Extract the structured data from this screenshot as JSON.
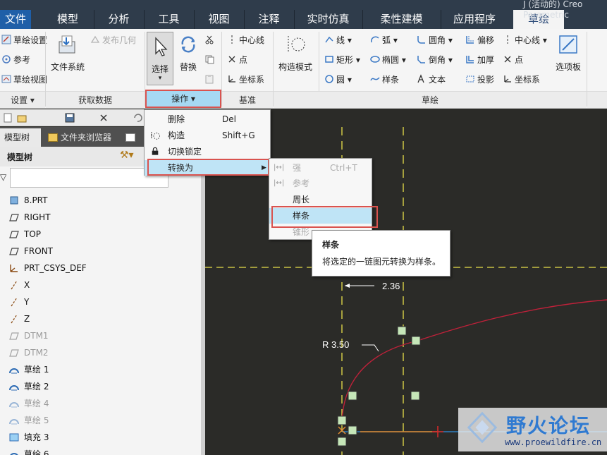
{
  "window": {
    "title_fragment": "J (活动的) Creo Parametric"
  },
  "menubar": {
    "tabs": [
      "文件",
      "模型",
      "分析",
      "工具",
      "视图",
      "注释",
      "实时仿真",
      "柔性建模",
      "应用程序",
      "草绘"
    ],
    "active": "草绘"
  },
  "ribbon": {
    "setup": {
      "sketch_setup": "草绘设置",
      "reference": "参考",
      "sketch_view": "草绘视图",
      "group": "设置"
    },
    "get_data": {
      "file_system": "文件系统",
      "publish_geom": "发布几何",
      "group": "获取数据"
    },
    "operations": {
      "select": "选择",
      "replace": "替换",
      "group": "操作"
    },
    "datum": {
      "centerline": "中心线",
      "point": "点",
      "csys": "坐标系",
      "group": "基准"
    },
    "sketch": {
      "construction_mode": "构造模式",
      "line": "线",
      "arc": "弧",
      "fillet": "圆角",
      "offset": "偏移",
      "rectangle": "矩形",
      "ellipse": "椭圆",
      "chamfer": "倒角",
      "thicken": "加厚",
      "circle": "圆",
      "spline": "样条",
      "text": "文本",
      "project": "投影",
      "centerline": "中心线",
      "point": "点",
      "csys": "坐标系",
      "group": "草绘"
    },
    "palette": "选项板"
  },
  "left_panel": {
    "tabs": [
      "模型树",
      "文件夹浏览器"
    ],
    "header": "模型树",
    "tree": [
      {
        "label": "8.PRT",
        "icon": "part-icon",
        "dim": false
      },
      {
        "label": "RIGHT",
        "icon": "datum-plane-icon",
        "dim": false
      },
      {
        "label": "TOP",
        "icon": "datum-plane-icon",
        "dim": false
      },
      {
        "label": "FRONT",
        "icon": "datum-plane-icon",
        "dim": false
      },
      {
        "label": "PRT_CSYS_DEF",
        "icon": "csys-icon",
        "dim": false
      },
      {
        "label": "X",
        "icon": "axis-icon",
        "dim": false
      },
      {
        "label": "Y",
        "icon": "axis-icon",
        "dim": false
      },
      {
        "label": "Z",
        "icon": "axis-icon",
        "dim": false
      },
      {
        "label": "DTM1",
        "icon": "datum-plane-icon",
        "dim": true
      },
      {
        "label": "DTM2",
        "icon": "datum-plane-icon",
        "dim": true
      },
      {
        "label": "草绘 1",
        "icon": "sketch-icon",
        "dim": false
      },
      {
        "label": "草绘 2",
        "icon": "sketch-icon",
        "dim": false
      },
      {
        "label": "草绘 4",
        "icon": "sketch-icon",
        "dim": true
      },
      {
        "label": "草绘 5",
        "icon": "sketch-icon",
        "dim": true
      },
      {
        "label": "填充 3",
        "icon": "fill-icon",
        "dim": false
      },
      {
        "label": "草绘 6",
        "icon": "sketch-icon",
        "dim": false
      }
    ]
  },
  "operations_menu": {
    "items": [
      {
        "label": "删除",
        "shortcut": "Del"
      },
      {
        "label": "构造",
        "shortcut": "Shift+G"
      },
      {
        "label": "切换锁定",
        "shortcut": ""
      },
      {
        "label": "转换为",
        "shortcut": ""
      }
    ]
  },
  "convert_submenu": {
    "items": [
      {
        "label": "强",
        "shortcut": "Ctrl+T",
        "disabled": true
      },
      {
        "label": "参考",
        "shortcut": "",
        "disabled": true
      },
      {
        "label": "周长",
        "shortcut": "",
        "disabled": false
      },
      {
        "label": "样条",
        "shortcut": "",
        "disabled": false
      },
      {
        "label": "锥形",
        "shortcut": "",
        "disabled": true
      }
    ]
  },
  "tooltip": {
    "title": "样条",
    "description": "将选定的一链图元转换为样条。"
  },
  "canvas": {
    "dim_horizontal": "2.36",
    "dim_radius": "R 3.50"
  },
  "watermark": {
    "title": "野火论坛",
    "url": "www.proewildfire.cn"
  },
  "colors": {
    "menubar": "#2f3c4b",
    "canvas": "#2b2b28",
    "highlight": "#bfe4f6",
    "redbox": "#d9534f",
    "sketch_curve": "#c0213a",
    "centerline": "#e8e04a"
  }
}
